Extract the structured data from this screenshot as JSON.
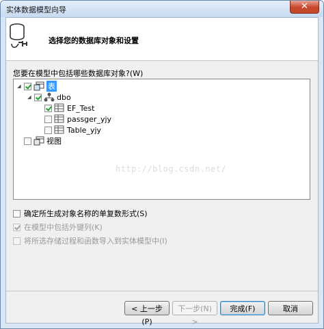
{
  "window": {
    "title": "实体数据模型向导"
  },
  "header": {
    "text": "选择您的数据库对象和设置"
  },
  "tree_label": "您要在模型中包括哪些数据库对象?(W)",
  "tree": {
    "tables": "表",
    "schema": "dbo",
    "items": [
      "EF_Test",
      "passger_yjy",
      "Table_yjy"
    ],
    "views": "视图"
  },
  "watermark": "http://blog.csdn.net/",
  "options": {
    "pluralize": "确定所生成对象名称的单复数形式(S)",
    "foreign_keys": "在模型中包括外键列(K)",
    "import_procs": "将所选存储过程和函数导入到实体模型中(I)"
  },
  "buttons": {
    "prev": "< 上一步(P)",
    "next": "下一步(N) >",
    "finish": "完成(F)",
    "cancel": "取消"
  },
  "colors": {
    "selection": "#3399ff",
    "title_bar": "#c7daf1",
    "close": "#c9452a"
  }
}
